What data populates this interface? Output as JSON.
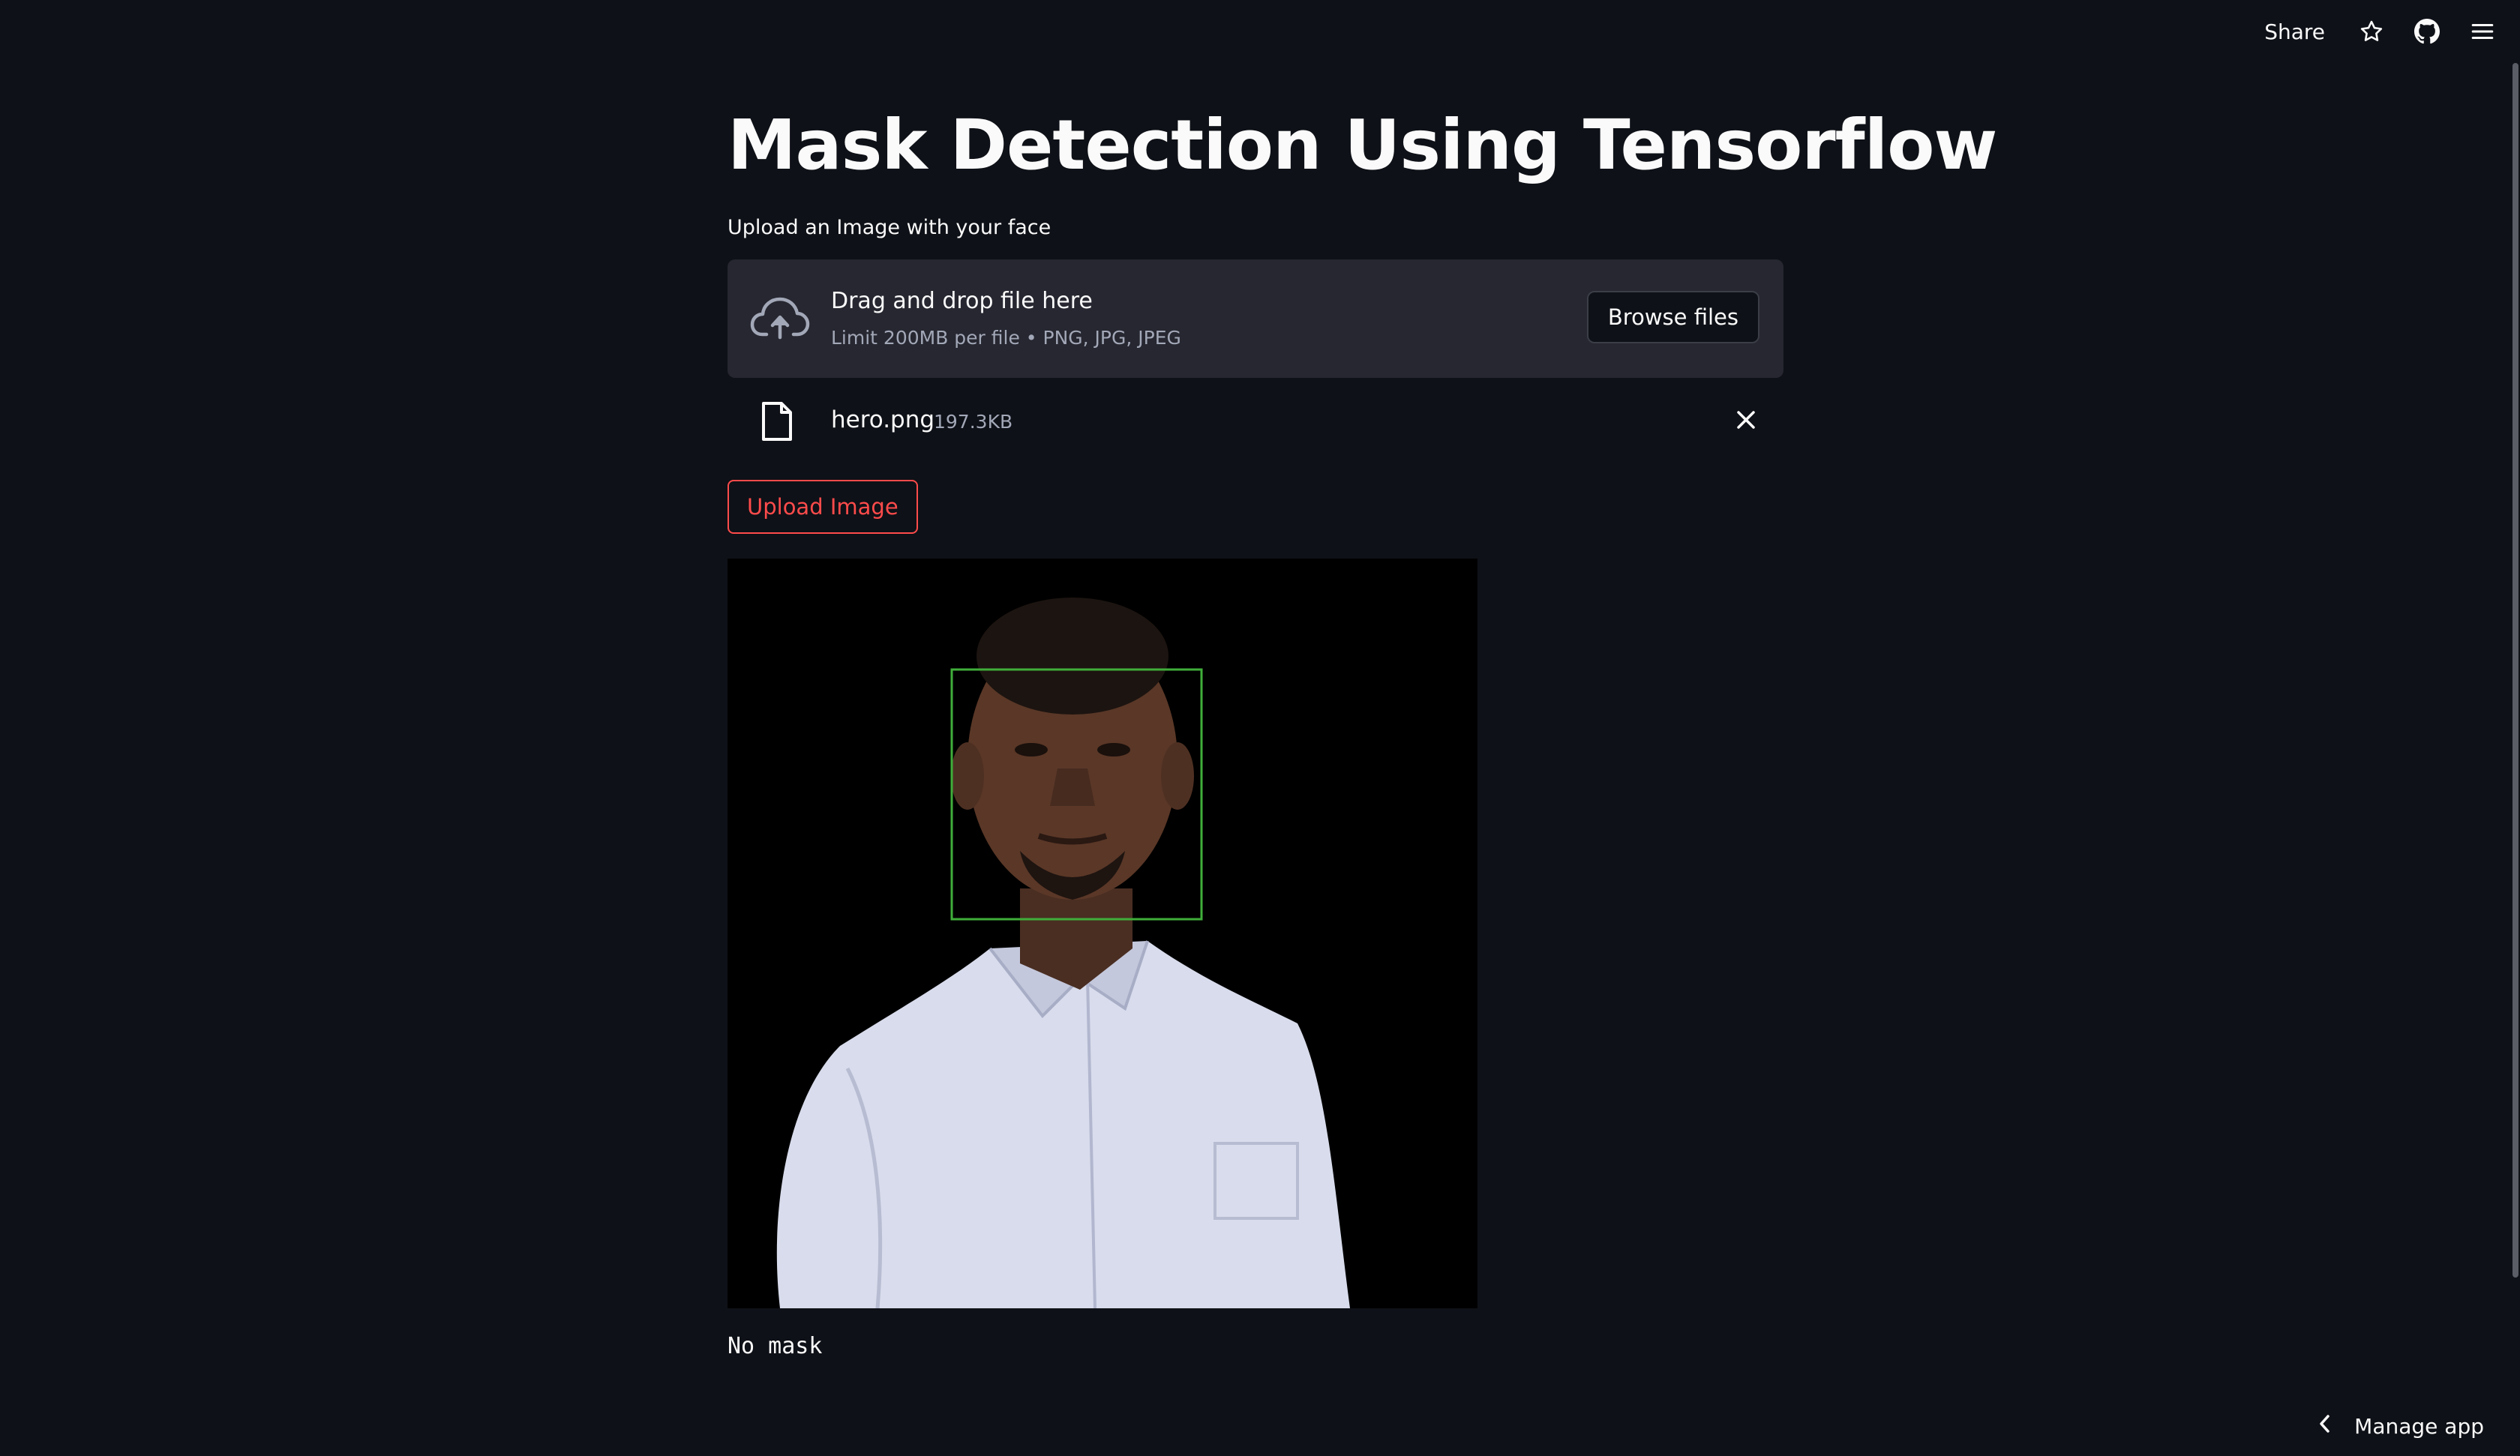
{
  "toolbar": {
    "share_label": "Share",
    "icons": [
      "star-icon",
      "github-icon",
      "hamburger-menu-icon"
    ]
  },
  "main": {
    "title": "Mask Detection Using Tensorflow",
    "uploader": {
      "label": "Upload an Image with your face",
      "dropzone_title": "Drag and drop file here",
      "dropzone_limit": "Limit 200MB per file • PNG, JPG, JPEG",
      "browse_label": "Browse files"
    },
    "uploaded_file": {
      "name": "hero.png",
      "size": "197.3KB"
    },
    "upload_button_label": "Upload Image",
    "result": {
      "image_alt": "Uploaded portrait with detected face bounding box",
      "caption": "No mask"
    }
  },
  "footer": {
    "manage_label": "Manage app"
  },
  "colors": {
    "background": "#0e1117",
    "surface": "#262730",
    "accent": "#ff4b4b",
    "detection_box": "#3fae3a"
  }
}
